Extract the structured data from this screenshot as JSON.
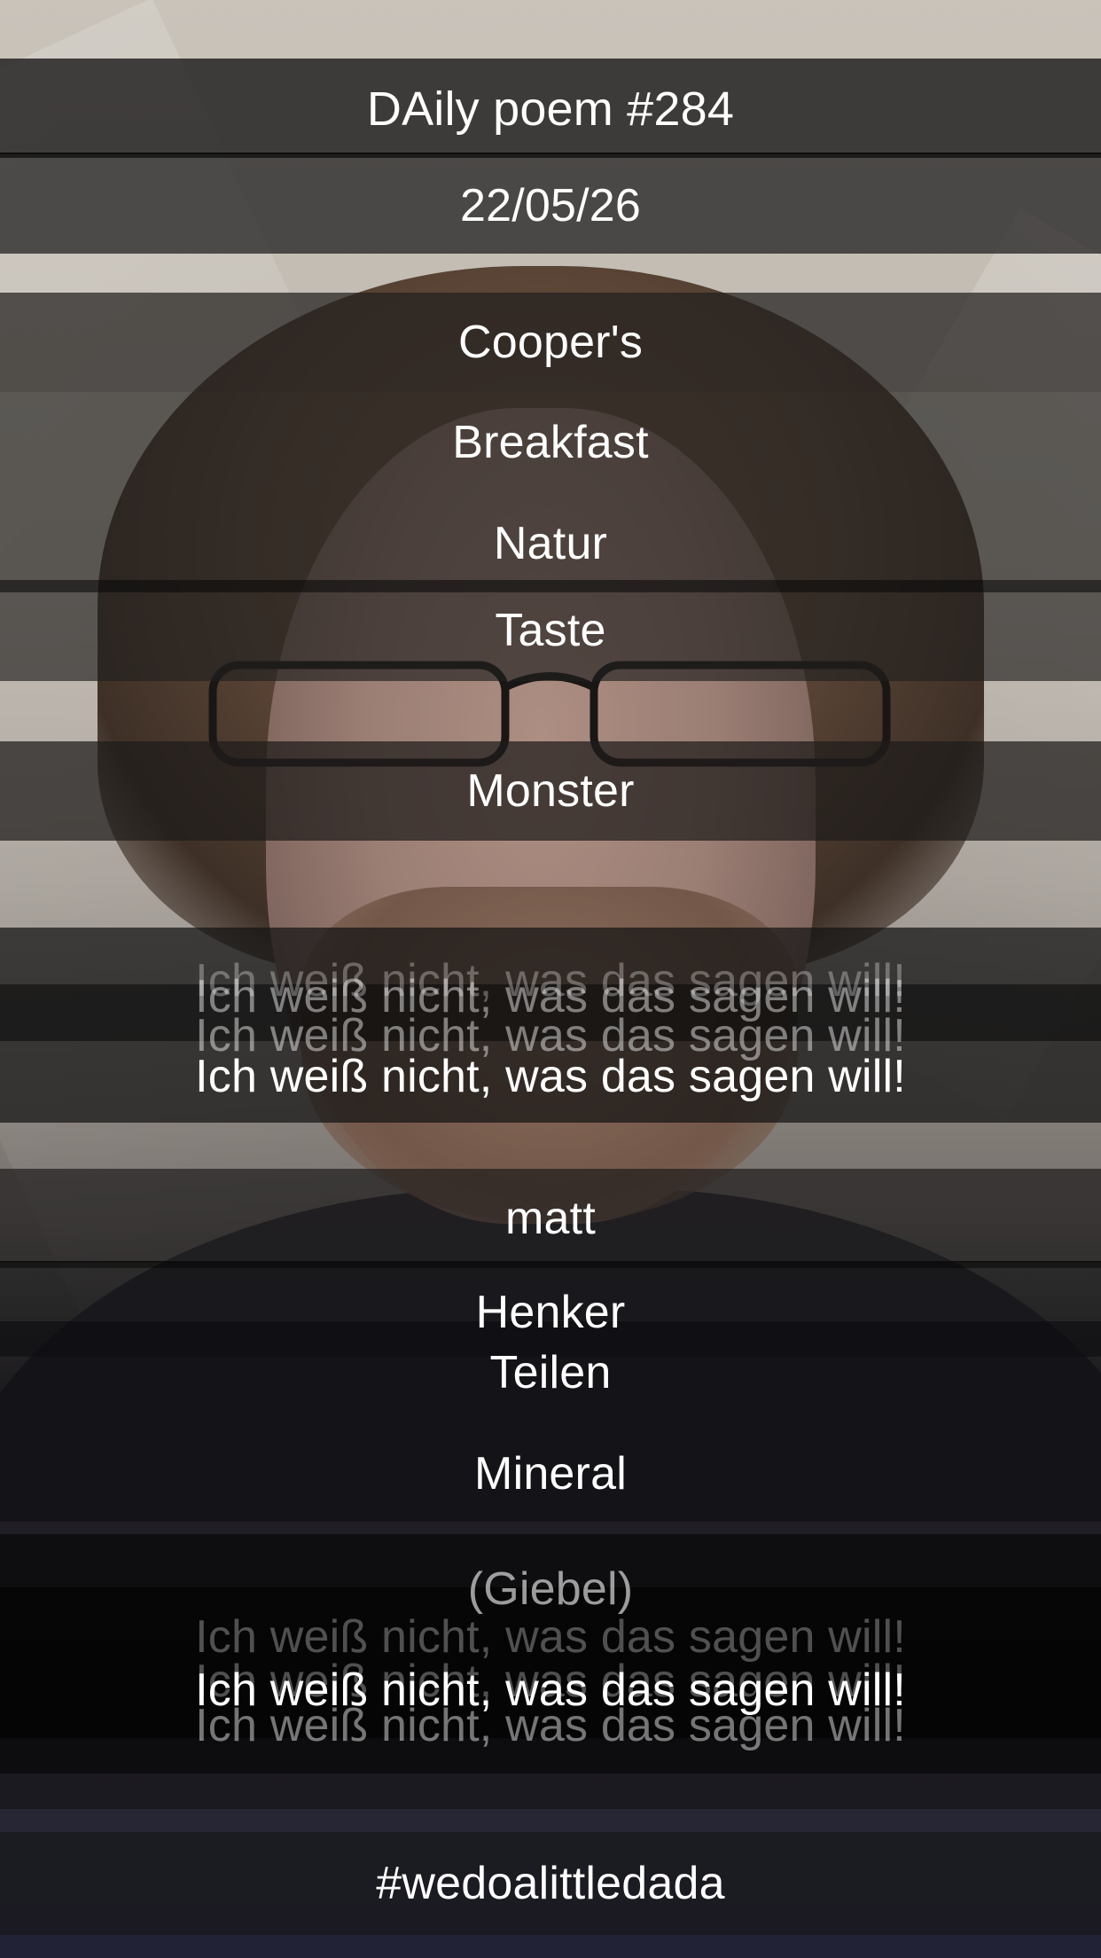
{
  "title": "DAily poem #284",
  "date": "22/05/26",
  "lines": {
    "l1": "Cooper's",
    "l2": "Breakfast",
    "l3": "Natur",
    "l4": "Taste",
    "l5": "Monster",
    "l6": "Ich weiß nicht, was das sagen will!",
    "l7": "matt",
    "l8": "Henker",
    "l9": "Teilen",
    "l10": "Mineral",
    "l11": "(Giebel)",
    "l12": "Ich weiß nicht, was das sagen will!"
  },
  "hashtag": "#wedoalittledada",
  "colors": {
    "strip": "#1e1d1d",
    "text": "#ffffff"
  }
}
